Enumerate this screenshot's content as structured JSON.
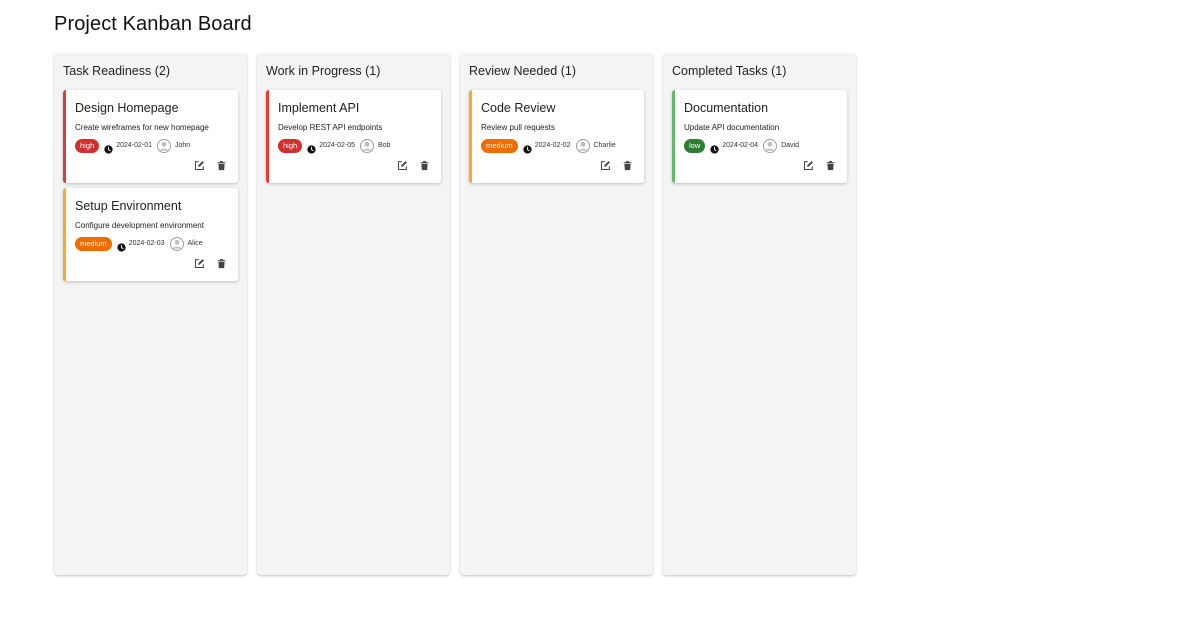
{
  "page": {
    "title": "Project Kanban Board"
  },
  "priority_colors": {
    "high": "#d32f2f",
    "medium": "#ef6c00",
    "low": "#2e7d32"
  },
  "border_colors": {
    "high": "#e53935",
    "medium": "#ffa726",
    "low": "#66bb6a"
  },
  "icons": {
    "due": "clock-icon",
    "assignee": "avatar-icon",
    "edit": "edit-icon",
    "delete": "trash-icon"
  },
  "columns": [
    {
      "title": "Task Readiness (2)",
      "cards": [
        {
          "title": "Design Homepage",
          "description": "Create wireframes for new homepage",
          "priority": "high",
          "due": "2024-02-01",
          "assignee": "John"
        },
        {
          "title": "Setup Environment",
          "description": "Configure development environment",
          "priority": "medium",
          "due": "2024-02-03",
          "assignee": "Alice"
        }
      ]
    },
    {
      "title": "Work in Progress (1)",
      "cards": [
        {
          "title": "Implement API",
          "description": "Develop REST API endpoints",
          "priority": "high",
          "due": "2024-02-05",
          "assignee": "Bob"
        }
      ]
    },
    {
      "title": "Review Needed (1)",
      "cards": [
        {
          "title": "Code Review",
          "description": "Review pull requests",
          "priority": "medium",
          "due": "2024-02-02",
          "assignee": "Charlie"
        }
      ]
    },
    {
      "title": "Completed Tasks (1)",
      "cards": [
        {
          "title": "Documentation",
          "description": "Update API documentation",
          "priority": "low",
          "due": "2024-02-04",
          "assignee": "David"
        }
      ]
    }
  ]
}
